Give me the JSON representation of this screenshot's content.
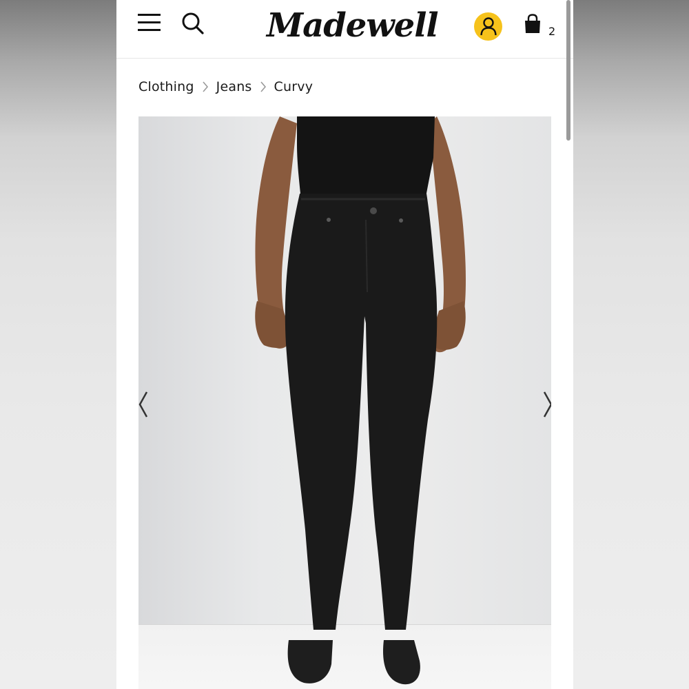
{
  "header": {
    "logo_text": "Madewell",
    "bag_count": "2",
    "icons": [
      "menu-icon",
      "search-icon",
      "account-icon",
      "shopping-bag-icon"
    ],
    "account_icon_color": "#f6c21b"
  },
  "breadcrumb": {
    "items": [
      {
        "label": "Clothing"
      },
      {
        "label": "Jeans"
      },
      {
        "label": "Curvy"
      }
    ]
  },
  "product": {
    "carousel_icons": [
      "chevron-left-icon",
      "chevron-right-icon"
    ]
  }
}
